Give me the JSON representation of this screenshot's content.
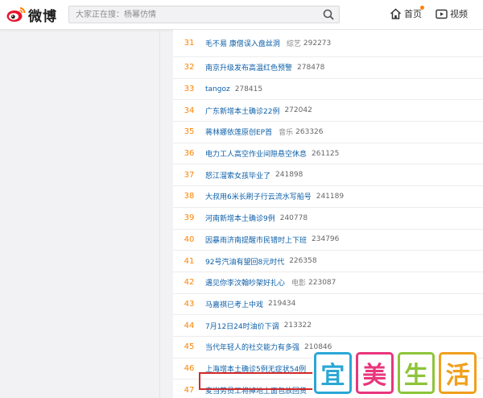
{
  "header": {
    "logo_text": "微博",
    "search_placeholder": "大家正在搜：杨幂仿情",
    "home_label": "首页",
    "video_label": "视频"
  },
  "hot_list": [
    {
      "rank": "31",
      "title": "毛不易 康僧误入盘丝洞",
      "tag": "综艺",
      "count": "292273"
    },
    {
      "rank": "32",
      "title": "南京升级发布高温红色预警",
      "tag": "",
      "count": "278478"
    },
    {
      "rank": "33",
      "title": "tangoz",
      "tag": "",
      "count": "278415"
    },
    {
      "rank": "34",
      "title": "广东新增本土确诊22例",
      "tag": "",
      "count": "272042"
    },
    {
      "rank": "35",
      "title": "蒋林娜依莲原创EP首",
      "tag": "音乐",
      "count": "263326"
    },
    {
      "rank": "36",
      "title": "电力工人高空作业间隙悬空休息",
      "tag": "",
      "count": "261125"
    },
    {
      "rank": "37",
      "title": "怒江溜索女孩毕业了",
      "tag": "",
      "count": "241898"
    },
    {
      "rank": "38",
      "title": "大叔用6米长刷子行云流水写船号",
      "tag": "",
      "count": "241189"
    },
    {
      "rank": "39",
      "title": "河南新增本土确诊9例",
      "tag": "",
      "count": "240778"
    },
    {
      "rank": "40",
      "title": "因暴雨济南提醒市民错时上下班",
      "tag": "",
      "count": "234796"
    },
    {
      "rank": "41",
      "title": "92号汽油有望回8元时代",
      "tag": "",
      "count": "226358"
    },
    {
      "rank": "42",
      "title": "遇见你李汶翰吵架好扎心",
      "tag": "电影",
      "count": "223087"
    },
    {
      "rank": "43",
      "title": "马嘉祺已考上中戏",
      "tag": "",
      "count": "219434"
    },
    {
      "rank": "44",
      "title": "7月12日24时油价下调",
      "tag": "",
      "count": "213322"
    },
    {
      "rank": "45",
      "title": "当代年轻人的社交能力有多强",
      "tag": "",
      "count": "210846"
    },
    {
      "rank": "46",
      "title": "上海增本土确诊5例无症状54例",
      "tag": "",
      "count": ""
    },
    {
      "rank": "47",
      "title": "麦当劳员工将掉地上面包放回货",
      "tag": "",
      "count": ""
    }
  ],
  "watermark": [
    "宜",
    "美",
    "生",
    "活"
  ],
  "colors": {
    "accent": "#ff8200",
    "link": "#0c5fa8",
    "highlight": "#d32828"
  }
}
